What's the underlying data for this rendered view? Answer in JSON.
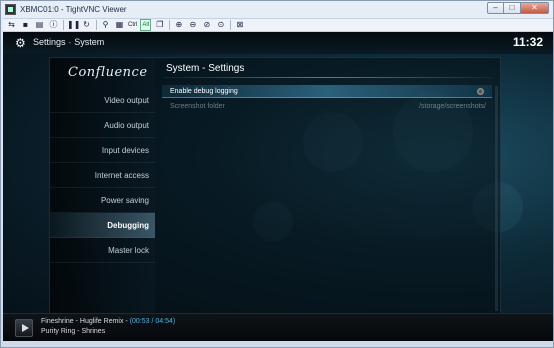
{
  "window": {
    "title": "XBMC01:0 - TightVNC Viewer",
    "controls": {
      "minimize": "–",
      "maximize": "□",
      "close": "✕"
    }
  },
  "toolbar": {
    "ctrl_label": "Ctrl",
    "alt_label": "Alt"
  },
  "header": {
    "breadcrumb_root": "Settings",
    "breadcrumb_separator": "-",
    "breadcrumb_page": "System",
    "clock": "11:32"
  },
  "sidebar": {
    "logo": "Confluence",
    "items": [
      {
        "label": "Video output"
      },
      {
        "label": "Audio output"
      },
      {
        "label": "Input devices"
      },
      {
        "label": "Internet access"
      },
      {
        "label": "Power saving"
      },
      {
        "label": "Debugging"
      },
      {
        "label": "Master lock"
      }
    ],
    "active_item": "Debugging"
  },
  "main": {
    "title": "System - Settings",
    "settings": [
      {
        "label": "Enable debug logging",
        "value": ""
      },
      {
        "label": "Screenshot folder",
        "value": "/storage/screenshots/"
      }
    ]
  },
  "now_playing": {
    "line1_prefix": "Fineshrine - Huglife Remix - ",
    "time": "(00:53 / 04:54)",
    "line2": "Purity Ring - Shrines"
  },
  "colors": {
    "accent": "#4fb3e6",
    "background": "#0d2a38"
  }
}
